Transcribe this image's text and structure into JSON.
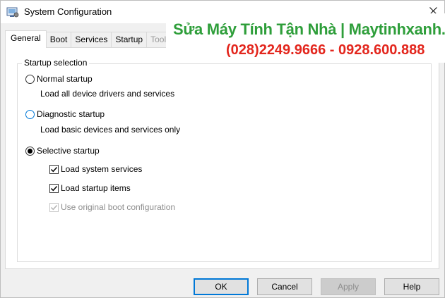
{
  "window": {
    "title": "System Configuration",
    "app_icon": "system-config-icon",
    "close_icon": "close-icon"
  },
  "tabs": [
    {
      "label": "General",
      "active": true
    },
    {
      "label": "Boot",
      "active": false
    },
    {
      "label": "Services",
      "active": false
    },
    {
      "label": "Startup",
      "active": false
    },
    {
      "label": "Tools",
      "active": false
    }
  ],
  "startup_selection": {
    "group_label": "Startup selection",
    "normal": {
      "label": "Normal startup",
      "description": "Load all device drivers and services",
      "selected": false
    },
    "diagnostic": {
      "label": "Diagnostic startup",
      "description": "Load basic devices and services only",
      "selected": false
    },
    "selective": {
      "label": "Selective startup",
      "selected": true,
      "options": [
        {
          "label": "Load system services",
          "checked": true,
          "enabled": true
        },
        {
          "label": "Load startup items",
          "checked": true,
          "enabled": true
        },
        {
          "label": "Use original boot configuration",
          "checked": true,
          "enabled": false
        }
      ]
    }
  },
  "buttons": {
    "ok": "OK",
    "cancel": "Cancel",
    "apply": "Apply",
    "help": "Help"
  },
  "banner": {
    "line1": "Sửa Máy Tính Tận Nhà | Maytinhxanh.vn",
    "line2": "(028)2249.9666 - 0928.600.888",
    "color1": "#2e9e3a",
    "color2": "#e3261d"
  }
}
